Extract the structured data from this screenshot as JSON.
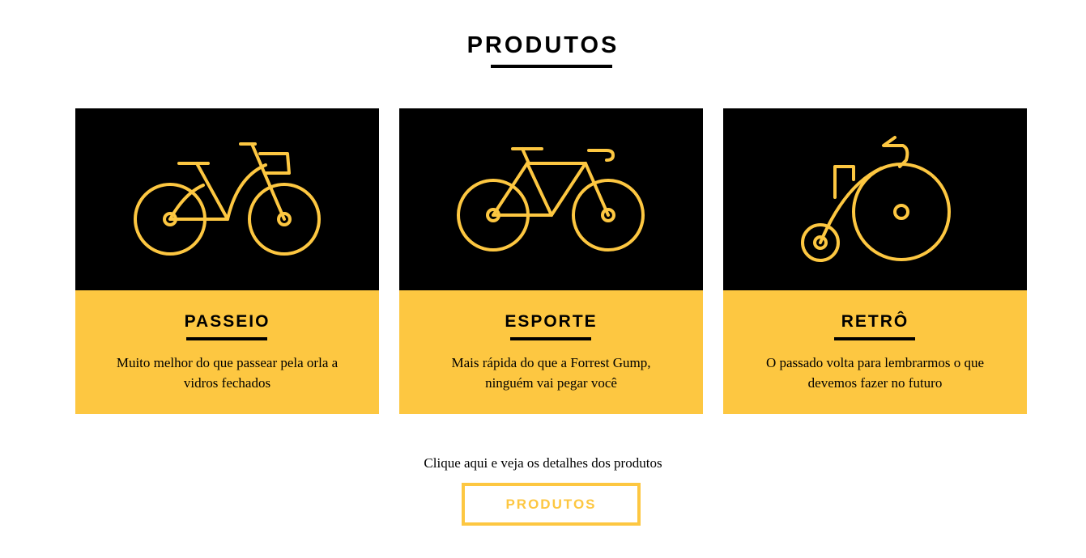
{
  "section": {
    "title": "PRODUTOS"
  },
  "products": [
    {
      "title": "PASSEIO",
      "description": "Muito melhor do que passear pela orla a vidros fechados",
      "icon": "city-bike-icon"
    },
    {
      "title": "ESPORTE",
      "description": "Mais rápida do que a Forrest Gump, ninguém vai pegar você",
      "icon": "road-bike-icon"
    },
    {
      "title": "RETRÔ",
      "description": "O passado volta para lembrarmos o que devemos fazer no futuro",
      "icon": "penny-farthing-icon"
    }
  ],
  "cta": {
    "text": "Clique aqui e veja os detalhes dos produtos",
    "button_label": "PRODUTOS"
  },
  "colors": {
    "accent": "#fdc741",
    "dark": "#000000",
    "background": "#ffffff"
  }
}
